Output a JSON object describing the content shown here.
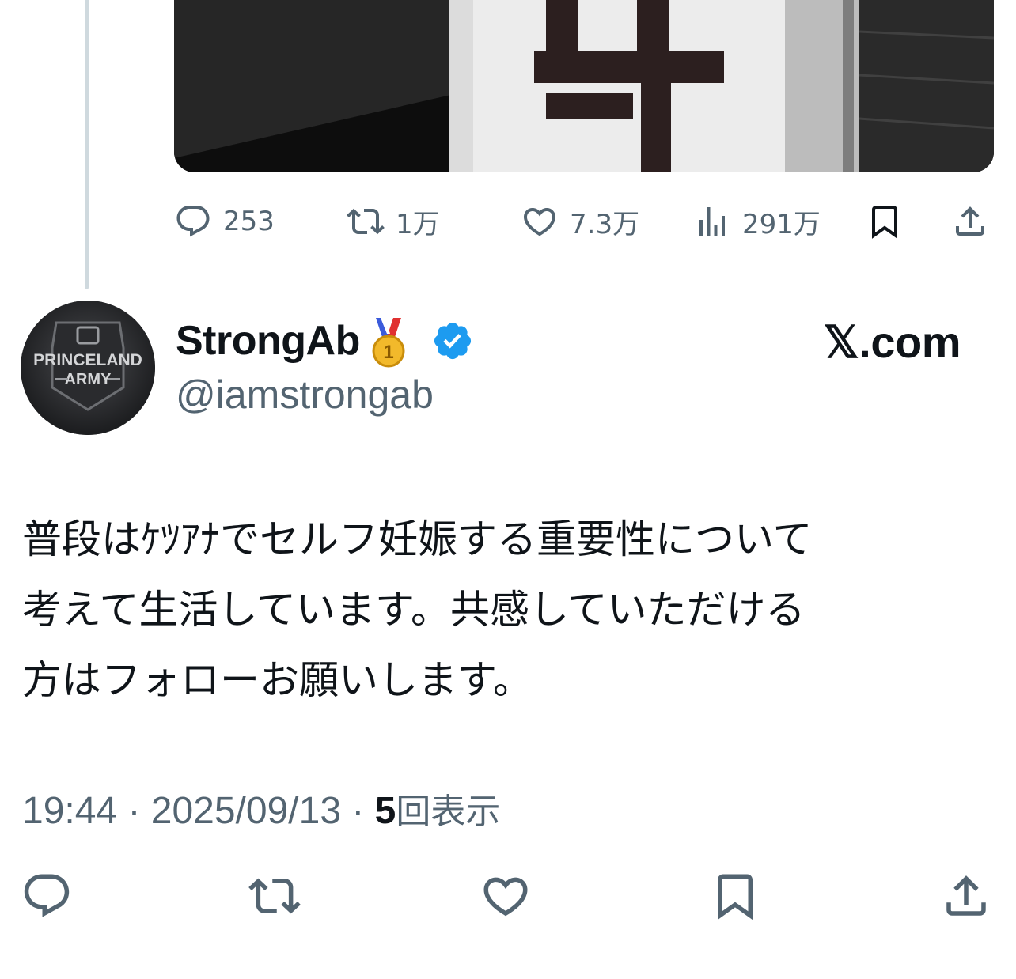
{
  "previous_tweet": {
    "media_alt": "photo",
    "stats": {
      "replies": "253",
      "reposts": "1万",
      "likes": "7.3万",
      "views": "291万"
    }
  },
  "tweet": {
    "display_name": "StrongAb",
    "handle": "@iamstrongab",
    "brand": "𝕏.com",
    "avatar_text_line1": "PRINCELAND",
    "avatar_text_line2": "ARMY",
    "text": "普段はｹﾂｱﾅでセルフ妊娠する重要性について\n考えて生活しています。共感していただける\n方はフォローお願いします。",
    "time": "19:44",
    "date": "2025/09/13",
    "separator": " · ",
    "views_count": "5",
    "views_label": "回表示"
  },
  "colors": {
    "secondary_text": "#536471",
    "primary_text": "#0f1419",
    "verified_blue": "#1d9bf0",
    "thread_line": "#cfd9de"
  },
  "icons": {
    "reply": "reply-icon",
    "repost": "repost-icon",
    "like": "like-icon",
    "views": "views-icon",
    "bookmark": "bookmark-icon",
    "share": "share-icon",
    "verified": "verified-badge-icon",
    "medal": "first-place-medal-icon"
  }
}
